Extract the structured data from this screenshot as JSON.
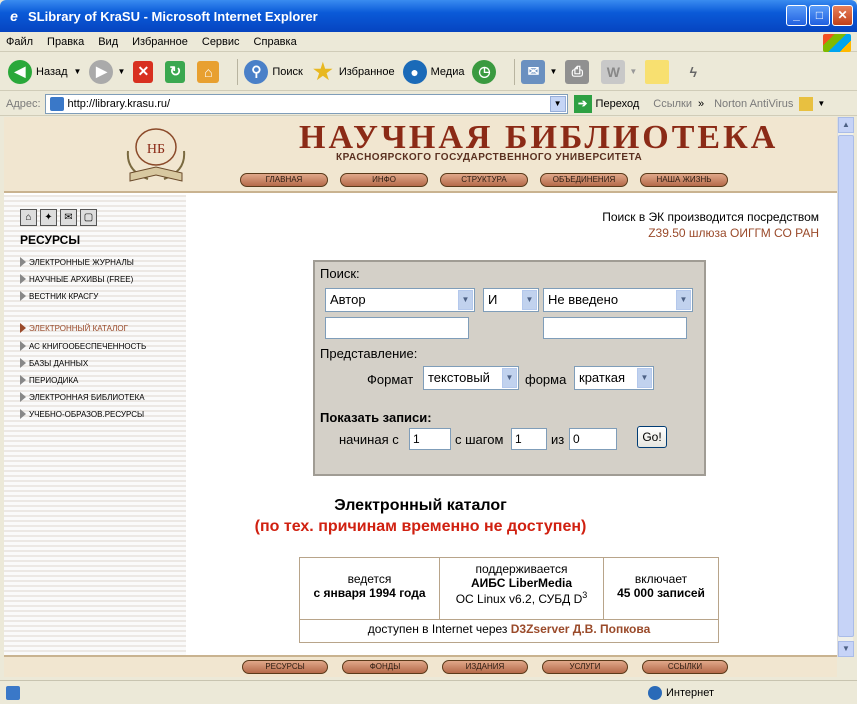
{
  "window": {
    "title": "SLibrary of KraSU - Microsoft Internet Explorer"
  },
  "menu": [
    "Файл",
    "Правка",
    "Вид",
    "Избранное",
    "Сервис",
    "Справка"
  ],
  "toolbar": {
    "back": "Назад",
    "search": "Поиск",
    "favorites": "Избранное",
    "media": "Медиа"
  },
  "address": {
    "label": "Адрес:",
    "url": "http://library.krasu.ru/",
    "go": "Переход",
    "links": "Ссылки",
    "antivirus": "Norton AntiVirus"
  },
  "header": {
    "title": "НАУЧНАЯ БИБЛИОТЕКА",
    "subtitle": "КРАСНОЯРСКОГО ГОСУДАРСТВЕННОГО УНИВЕРСИТЕТА",
    "nav": [
      "ГЛАВНАЯ",
      "ИНФО",
      "СТРУКТУРА",
      "ОБЪЕДИНЕНИЯ",
      "НАША ЖИЗНЬ"
    ]
  },
  "sidebar": {
    "title": "РЕСУРСЫ",
    "group1": [
      "ЭЛЕКТРОННЫЕ ЖУРНАЛЫ",
      "НАУЧНЫЕ АРХИВЫ (FREE)",
      "ВЕСТНИК КРАСГУ"
    ],
    "group2": [
      "ЭЛЕКТРОННЫЙ КАТАЛОГ",
      "АС КНИГООБЕСПЕЧЕННОСТЬ",
      "БАЗЫ ДАННЫХ",
      "ПЕРИОДИКА",
      "ЭЛЕКТРОННАЯ БИБЛИОТЕКА",
      "УЧЕБНО-ОБРАЗОВ.РЕСУРСЫ"
    ]
  },
  "note": {
    "line1": "Поиск в ЭК производится посредством",
    "line2": "Z39.50 шлюза ОИГГМ СО РАН"
  },
  "search": {
    "label": "Поиск:",
    "field": "Автор",
    "op": "И",
    "field2": "Не введено",
    "repr_label": "Представление:",
    "format_label": "Формат",
    "format": "текстовый",
    "form_label": "форма",
    "form": "краткая",
    "show_label": "Показать записи:",
    "start_label": "начиная с",
    "start": "1",
    "step_label": "с шагом",
    "step": "1",
    "of_label": "из",
    "of": "0",
    "go": "Go!"
  },
  "catalog": {
    "title": "Электронный каталог",
    "warning": "(по тех. причинам временно не доступен)"
  },
  "info": {
    "c1a": "ведется",
    "c1b": "с января 1994 года",
    "c2a": "поддерживается",
    "c2b": "АИБС LiberMedia",
    "c2c": "ОС Linux v6.2, СУБД D",
    "c2sup": "3",
    "c3a": "включает",
    "c3b": "45 000 записей",
    "footer_a": "доступен в Internet через ",
    "footer_b": "D3Zserver Д.В. Попкова"
  },
  "bottomnav": [
    "РЕСУРСЫ",
    "ФОНДЫ",
    "ИЗДАНИЯ",
    "УСЛУГИ",
    "ССЫЛКИ"
  ],
  "status": {
    "zone": "Интернет"
  }
}
